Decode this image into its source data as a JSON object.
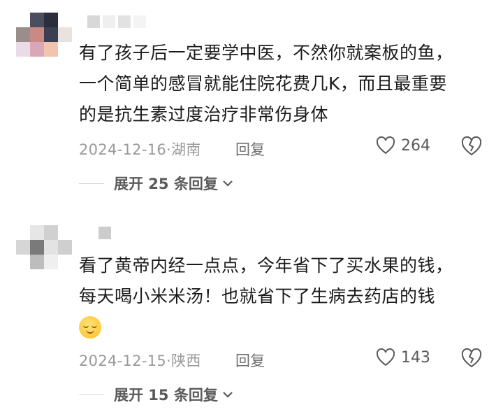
{
  "comments": [
    {
      "text_line1": "有了孩子后一定要学中医，不然你就案板的鱼，",
      "text_line2": "一个简单的感冒就能住院花费几K，而且最重要",
      "text_line3": "的是抗生素过度治疗非常伤身体",
      "date_location": "2024-12-16·湖南",
      "reply_label": "回复",
      "likes": "264",
      "expand_label": "展开 25 条回复",
      "avatar_colors": [
        "#ffffff",
        "#4a4e5e",
        "#2b2f3d",
        "#ffffff",
        "#9a8e8a",
        "#c98a86",
        "#3b3f52",
        "#e9e3e0",
        "#e9dce8",
        "#d9a7b7",
        "#f2c4ad",
        "#ffffff"
      ],
      "name_colors": [
        "#d8d8d8",
        "#efefef",
        "#e2e2e2",
        "#f4f4f4"
      ]
    },
    {
      "text_line1": "看了黄帝内经一点点，今年省下了买水果的钱，",
      "text_line2": "每天喝小米米汤！也就省下了生病去药店的钱",
      "date_location": "2024-12-15·陕西",
      "reply_label": "回复",
      "likes": "143",
      "expand_label": "展开 15 条回复",
      "avatar_colors": [
        "#ffffff",
        "#e6e6e6",
        "#d0d0d0",
        "#ffffff",
        "#d6d6d6",
        "#7a7a7a",
        "#e3e3e3",
        "#cfcfcf",
        "#ffffff",
        "#bdbdbd",
        "#efefef",
        "#ffffff"
      ],
      "name_colors": [
        "#cccccc",
        "#ffffff",
        "#ffffff",
        "#ffffff"
      ]
    }
  ],
  "icons": [
    "heart-outline-icon",
    "broken-heart-icon",
    "chevron-down-icon",
    "smiling-face-emoji"
  ]
}
